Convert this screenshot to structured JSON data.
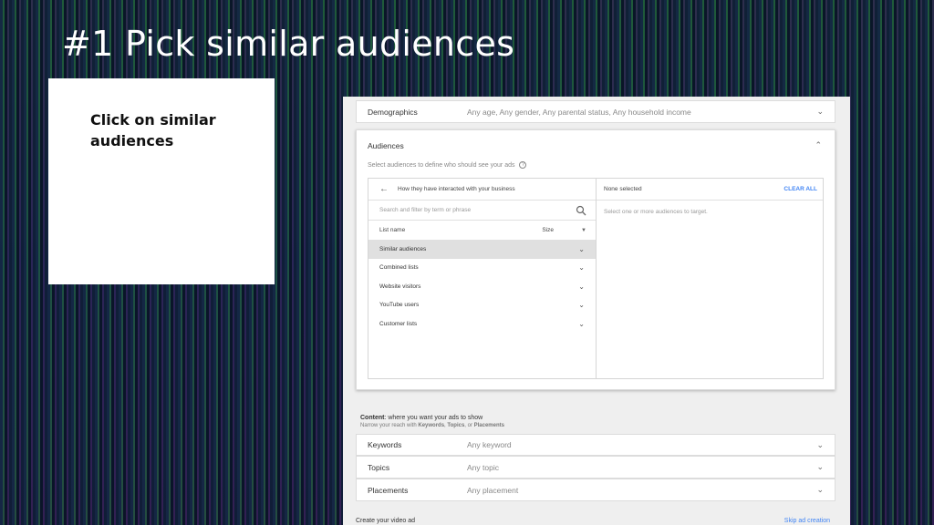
{
  "slide": {
    "title": "#1 Pick similar audiences",
    "note": "Click on similar audiences"
  },
  "demographics": {
    "label": "Demographics",
    "value": "Any age, Any gender, Any parental status, Any household income"
  },
  "audiences": {
    "title": "Audiences",
    "subtitle": "Select audiences to define who should see your ads",
    "help_icon": "?",
    "browse_header": "How they have interacted with your business",
    "search_placeholder": "Search and filter by term or phrase",
    "col_name": "List name",
    "col_size": "Size",
    "items": [
      {
        "label": "Similar audiences",
        "active": true
      },
      {
        "label": "Combined lists",
        "active": false
      },
      {
        "label": "Website visitors",
        "active": false
      },
      {
        "label": "YouTube users",
        "active": false
      },
      {
        "label": "Customer lists",
        "active": false
      }
    ],
    "selected_header": "None selected",
    "clear_all": "CLEAR ALL",
    "selected_hint": "Select one or more audiences to target."
  },
  "content": {
    "heading_bold": "Content",
    "heading_rest": ": where you want your ads to show",
    "sub_prefix": "Narrow your reach with ",
    "sub_kw": "Keywords",
    "sub_sep1": ", ",
    "sub_topics": "Topics",
    "sub_sep2": ", or ",
    "sub_placements": "Placements",
    "rows": [
      {
        "label": "Keywords",
        "value": "Any keyword"
      },
      {
        "label": "Topics",
        "value": "Any topic"
      },
      {
        "label": "Placements",
        "value": "Any placement"
      }
    ]
  },
  "footer": {
    "create_label": "Create your video ad",
    "skip_label": "Skip ad creation"
  },
  "icons": {
    "chevron_down": "⌄",
    "chevron_up": "⌃",
    "back_arrow": "←",
    "caret_down": "▼"
  }
}
